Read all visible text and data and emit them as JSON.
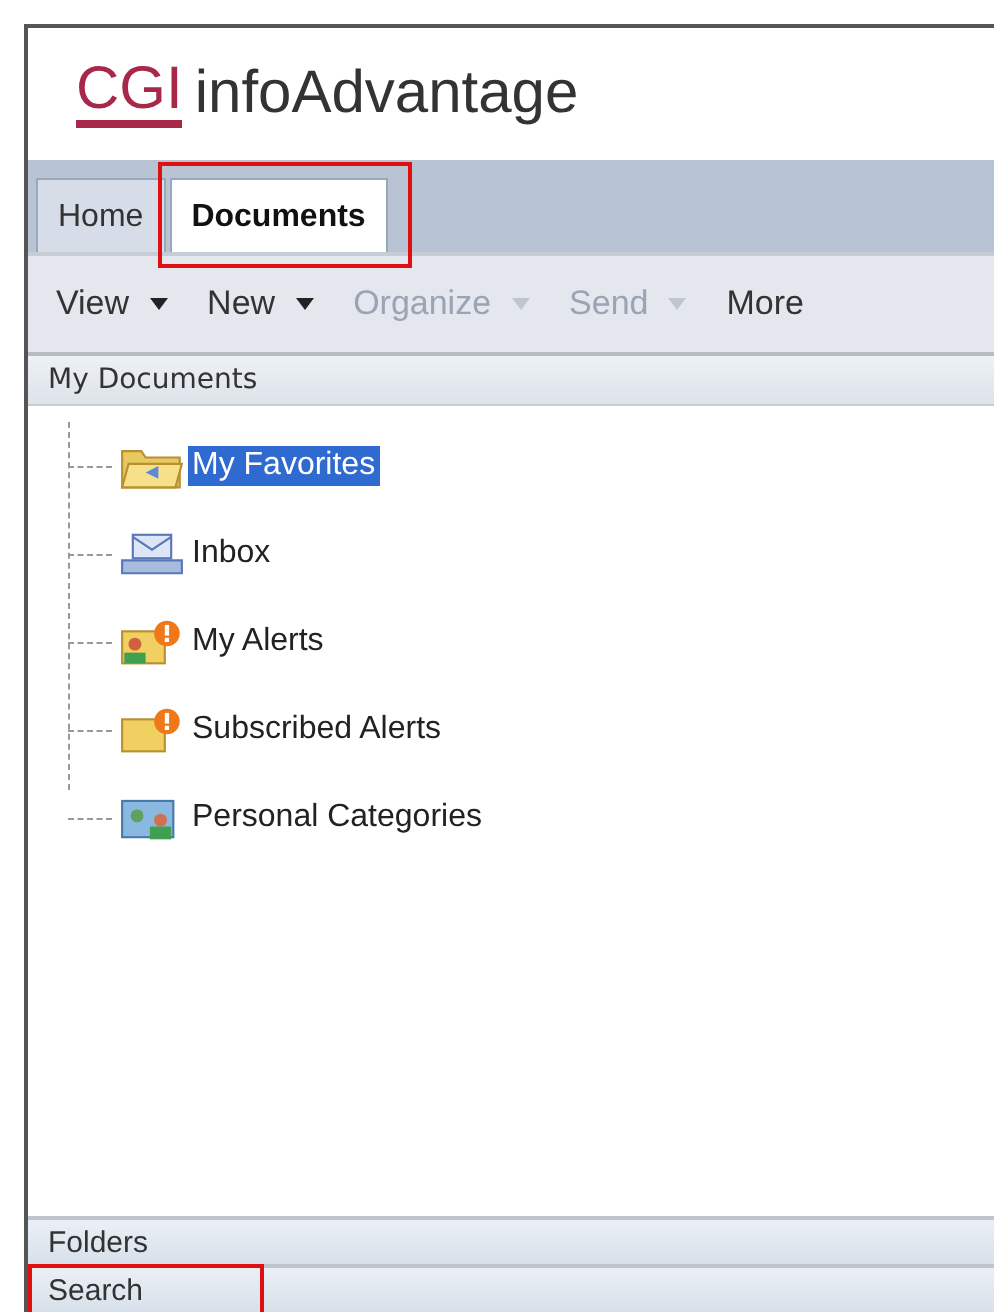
{
  "logo": {
    "mark": "CGI",
    "product": "infoAdvantage"
  },
  "tabs": [
    {
      "label": "Home",
      "selected": false,
      "highlighted": false
    },
    {
      "label": "Documents",
      "selected": true,
      "highlighted": true
    }
  ],
  "toolbar": [
    {
      "label": "View",
      "disabled": false
    },
    {
      "label": "New",
      "disabled": false
    },
    {
      "label": "Organize",
      "disabled": true
    },
    {
      "label": "Send",
      "disabled": true
    },
    {
      "label": "More",
      "disabled": false
    }
  ],
  "panel": {
    "title": "My Documents",
    "tree": [
      {
        "label": "My Favorites",
        "kind": "favorites",
        "selected": true
      },
      {
        "label": "Inbox",
        "kind": "inbox",
        "selected": false
      },
      {
        "label": "My Alerts",
        "kind": "alerts",
        "selected": false
      },
      {
        "label": "Subscribed Alerts",
        "kind": "subscribed",
        "selected": false
      },
      {
        "label": "Personal Categories",
        "kind": "categories",
        "selected": false
      }
    ]
  },
  "sections": [
    {
      "label": "Folders",
      "highlighted": false
    },
    {
      "label": "Search",
      "highlighted": true
    }
  ]
}
